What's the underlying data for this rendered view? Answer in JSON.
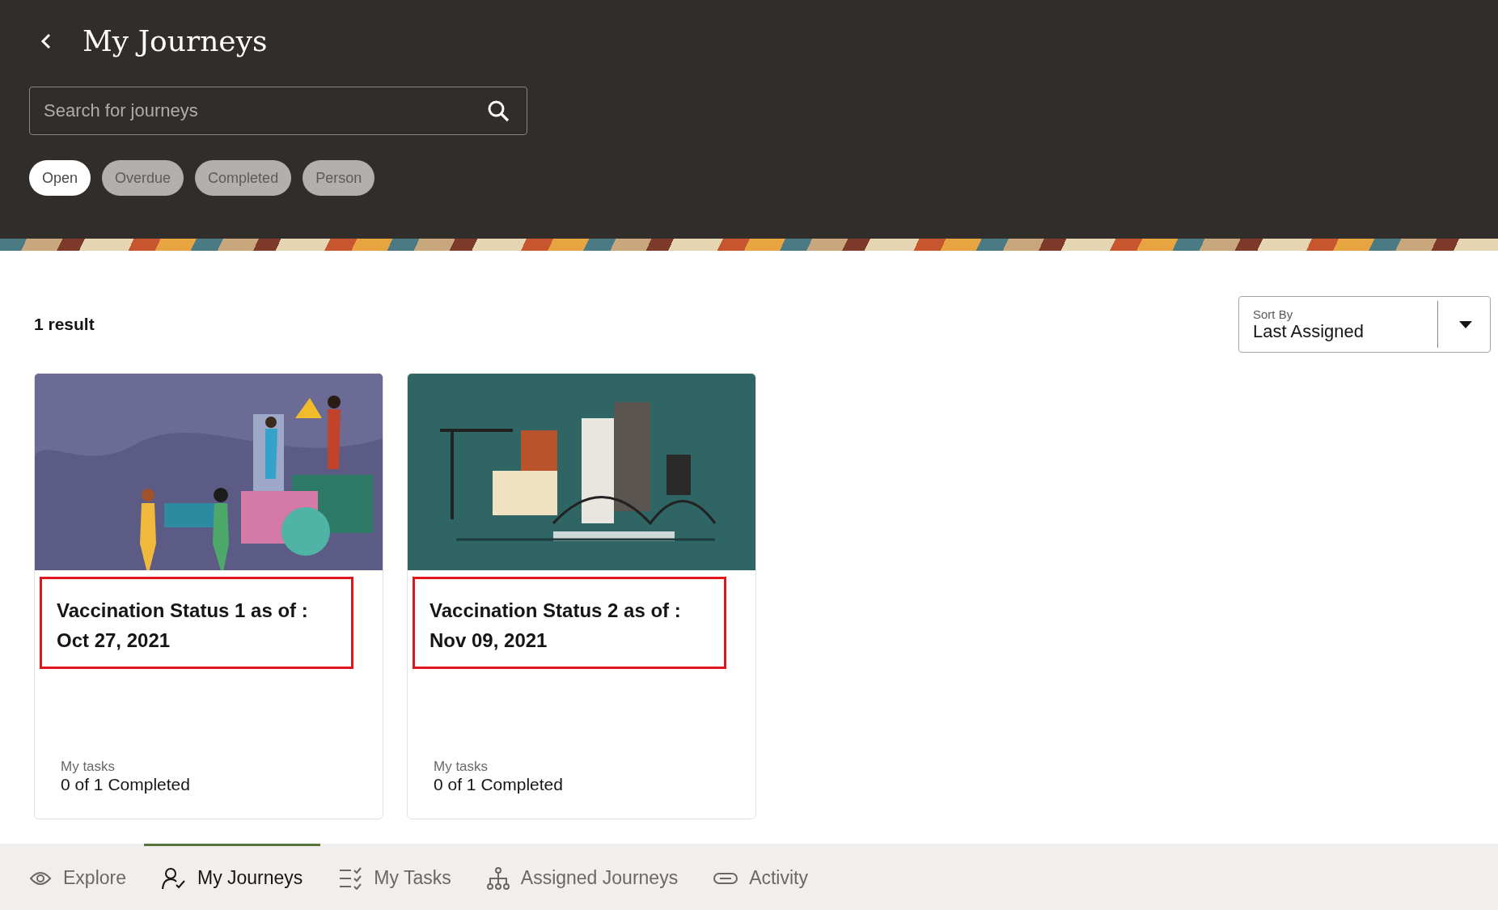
{
  "header": {
    "title": "My Journeys",
    "search": {
      "placeholder": "Search for journeys"
    },
    "filters": [
      {
        "label": "Open",
        "selected": true
      },
      {
        "label": "Overdue",
        "selected": false
      },
      {
        "label": "Completed",
        "selected": false
      },
      {
        "label": "Person",
        "selected": false
      }
    ]
  },
  "results": {
    "count": "1 result",
    "sort": {
      "label": "Sort By",
      "value": "Last Assigned"
    }
  },
  "cards": [
    {
      "kind": "people",
      "title": "Vaccination Status 1 as of : Oct 27, 2021",
      "highlighted": true,
      "tasks_label": "My tasks",
      "tasks_value": "0 of 1 Completed"
    },
    {
      "kind": "city",
      "title": "Vaccination Status 2 as of : Nov 09, 2021",
      "highlighted": true,
      "tasks_label": "My tasks",
      "tasks_value": "0 of 1 Completed"
    }
  ],
  "nav": [
    {
      "kind": "explore",
      "label": "Explore",
      "selected": false
    },
    {
      "kind": "journeys",
      "label": "My Journeys",
      "selected": true
    },
    {
      "kind": "tasks",
      "label": "My Tasks",
      "selected": false
    },
    {
      "kind": "assigned",
      "label": "Assigned Journeys",
      "selected": false
    },
    {
      "kind": "activity",
      "label": "Activity",
      "selected": false
    }
  ]
}
